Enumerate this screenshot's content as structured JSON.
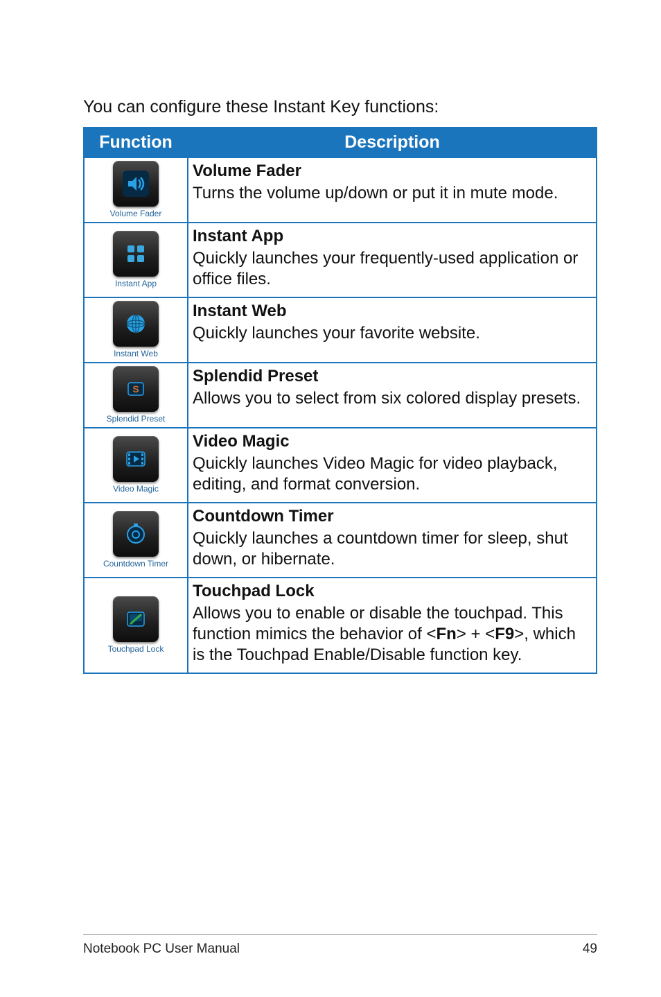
{
  "intro": "You can configure these Instant Key functions:",
  "table": {
    "headers": {
      "func": "Function",
      "desc": "Description"
    }
  },
  "rows": [
    {
      "icon_name": "volume-fader-icon",
      "caption": "Volume Fader",
      "title": "Volume Fader",
      "desc": "Turns the volume up/down or put it in mute mode."
    },
    {
      "icon_name": "instant-app-icon",
      "caption": "Instant App",
      "title": "Instant App",
      "desc": "Quickly launches your frequently-used application or office files."
    },
    {
      "icon_name": "instant-web-icon",
      "caption": "Instant Web",
      "title": "Instant Web",
      "desc": "Quickly launches your favorite website."
    },
    {
      "icon_name": "splendid-preset-icon",
      "caption": "Splendid Preset",
      "title": "Splendid Preset",
      "desc": "Allows you to select from six colored display presets."
    },
    {
      "icon_name": "video-magic-icon",
      "caption": "Video Magic",
      "title": "Video Magic",
      "desc": "Quickly launches Video Magic for video playback, editing, and format conversion."
    },
    {
      "icon_name": "countdown-timer-icon",
      "caption": "Countdown Timer",
      "title": "Countdown Timer",
      "desc": "Quickly launches a countdown timer for sleep, shut down, or hibernate."
    },
    {
      "icon_name": "touchpad-lock-icon",
      "caption": "Touchpad Lock",
      "title": "Touchpad Lock",
      "desc_pre": "Allows you to enable or disable the touchpad. This function mimics the behavior of <",
      "key1": "Fn",
      "mid": "> + <",
      "key2": "F9",
      "desc_post": ">, which is the Touchpad Enable/Disable function key."
    }
  ],
  "footer": {
    "left": "Notebook PC User Manual",
    "right": "49"
  }
}
